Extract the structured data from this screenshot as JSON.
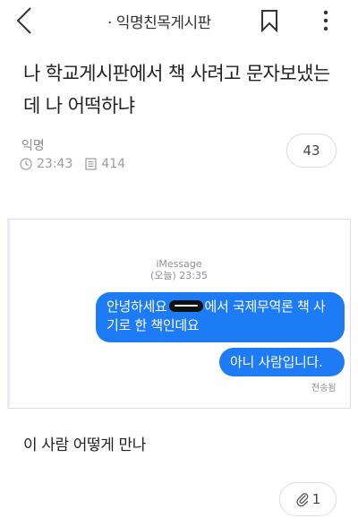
{
  "header": {
    "board_title": "· 익명친목게시판",
    "back_icon": "chevron-left-icon",
    "bookmark_icon": "bookmark-icon",
    "more_icon": "more-vertical-icon"
  },
  "post": {
    "title": "나 학교게시판에서 책 사려고 문자보냈는데 나 어떡하냐",
    "author": "익명",
    "time": "23:43",
    "views": "414",
    "comment_count": "43",
    "body_text": "이 사람 어떻게 만나",
    "attachment_count": "1"
  },
  "screenshot": {
    "service": "iMessage",
    "timestamp": "(오늘) 23:35",
    "message1_before": "안녕하세요",
    "message1_after": "에서 국제무역론 책 사기로 한 책인데요",
    "message2": "아니 사람입니다.",
    "delivery_status": "전송됨"
  },
  "colors": {
    "imessage_blue": "#1e7bf6",
    "meta_gray": "#9b9b9b"
  }
}
